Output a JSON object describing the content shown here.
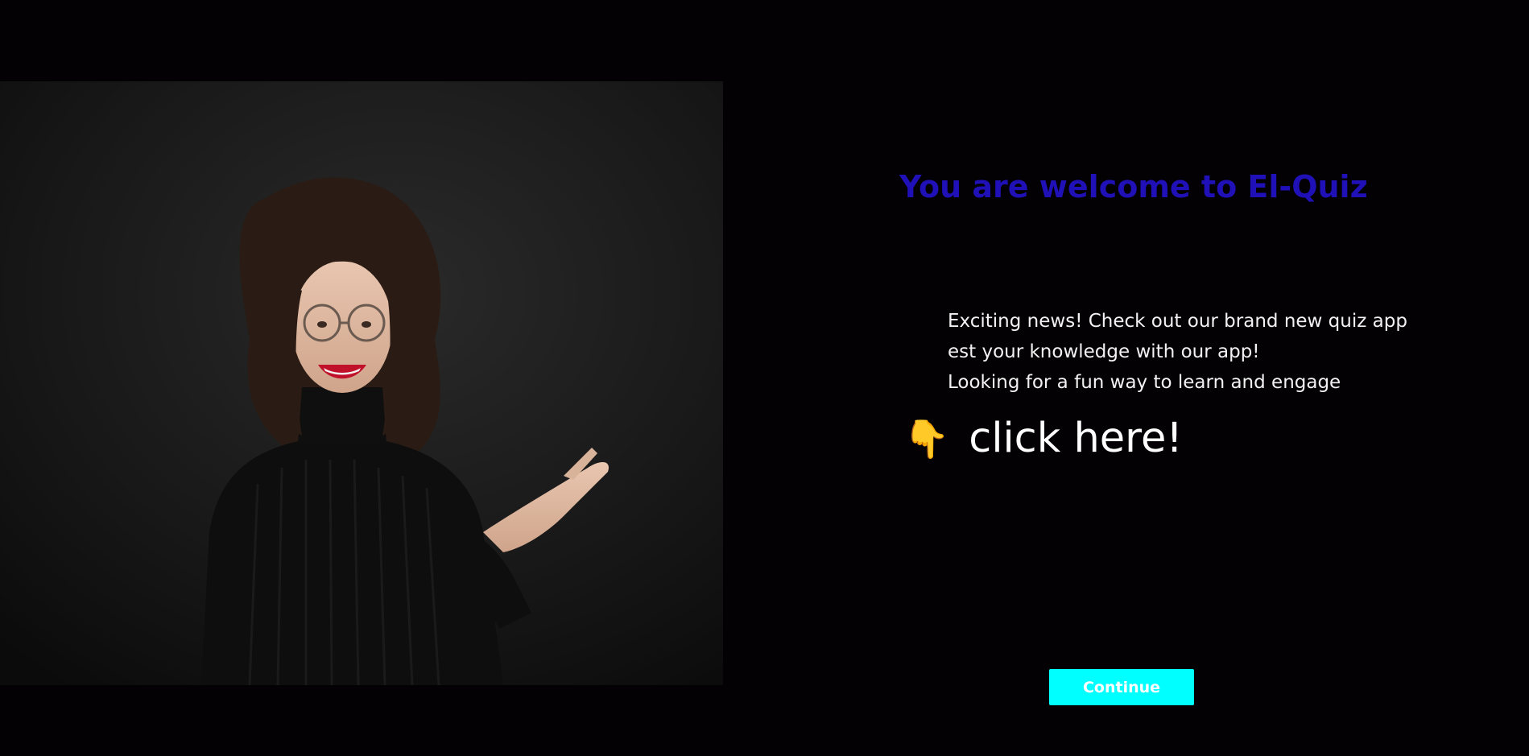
{
  "welcome": {
    "title": "You are welcome to El-Quiz",
    "lines": [
      "Exciting news! Check out our brand new quiz app",
      "est your knowledge with our app!",
      "Looking for a fun way to learn and engage"
    ],
    "cta_icon": "👇",
    "cta_text": "click here!",
    "continue_label": "Continue"
  },
  "icons": {
    "cta_icon_name": "pointing-down-hand-icon"
  },
  "colors": {
    "background": "#030103",
    "title": "#1f10b8",
    "body_text": "#f2f2f2",
    "cta_text": "#ffffff",
    "continue_button": "#00ffff"
  }
}
